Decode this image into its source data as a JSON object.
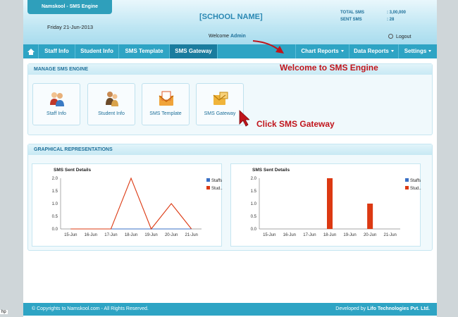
{
  "header": {
    "app_title": "Namskool - SMS Engine",
    "date": "Friday 21-Jun-2013",
    "school_name": "[SCHOOL NAME]",
    "welcome_prefix": "Welcome ",
    "user": "Admin",
    "total_sms_label": "TOTAL SMS",
    "total_sms_value": ": 3,00,000",
    "sent_sms_label": "SENT SMS",
    "sent_sms_value": ": 28",
    "logout": "Logout"
  },
  "nav": {
    "staff_info": "Staff Info",
    "student_info": "Student Info",
    "sms_template": "SMS Template",
    "sms_gateway": "SMS Gateway",
    "chart_reports": "Chart Reports",
    "data_reports": "Data Reports",
    "settings": "Settings"
  },
  "manage": {
    "title": "MANAGE SMS ENGINE",
    "tiles": [
      "Staff Info",
      "Student Info",
      "SMS Template",
      "SMS Gateway"
    ]
  },
  "callouts": {
    "welcome": "Welcome to SMS Engine",
    "click": "Click SMS Gateway"
  },
  "graph_panel": {
    "title": "GRAPHICAL REPRESENTATIONS"
  },
  "chart_data": [
    {
      "type": "line",
      "title": "SMS Sent Details",
      "categories": [
        "15-Jun",
        "16-Jun",
        "17-Jun",
        "18-Jun",
        "19-Jun",
        "20-Jun",
        "21-Jun"
      ],
      "series": [
        {
          "name": "Staffs",
          "values": [
            0,
            0,
            0,
            0,
            0,
            0,
            0
          ],
          "color": "#3a6fc4"
        },
        {
          "name": "Stud...",
          "values": [
            0,
            0,
            0,
            2,
            0,
            1,
            0
          ],
          "color": "#dc3912"
        }
      ],
      "yticks": [
        "0.0",
        "0.5",
        "1.0",
        "1.5",
        "2.0"
      ],
      "ylim": [
        0,
        2
      ],
      "legend": "right"
    },
    {
      "type": "bar",
      "title": "SMS Sent Details",
      "categories": [
        "15-Jun",
        "16-Jun",
        "17-Jun",
        "18-Jun",
        "19-Jun",
        "20-Jun",
        "21-Jun"
      ],
      "series": [
        {
          "name": "Staffs",
          "values": [
            0,
            0,
            0,
            0,
            0,
            0,
            0
          ],
          "color": "#3a6fc4"
        },
        {
          "name": "Stud...",
          "values": [
            0,
            0,
            0,
            2,
            0,
            1,
            0
          ],
          "color": "#dc3912"
        }
      ],
      "yticks": [
        "0.0",
        "0.5",
        "1.0",
        "1.5",
        "2.0"
      ],
      "ylim": [
        0,
        2
      ],
      "legend": "right"
    }
  ],
  "footer": {
    "copyright": "© Copyrights to Namskool.com - All Rights Reserved.",
    "developed_prefix": "Developed by ",
    "developer": "Lifo Technologies Pvt. Ltd.",
    "corner": "hp"
  }
}
